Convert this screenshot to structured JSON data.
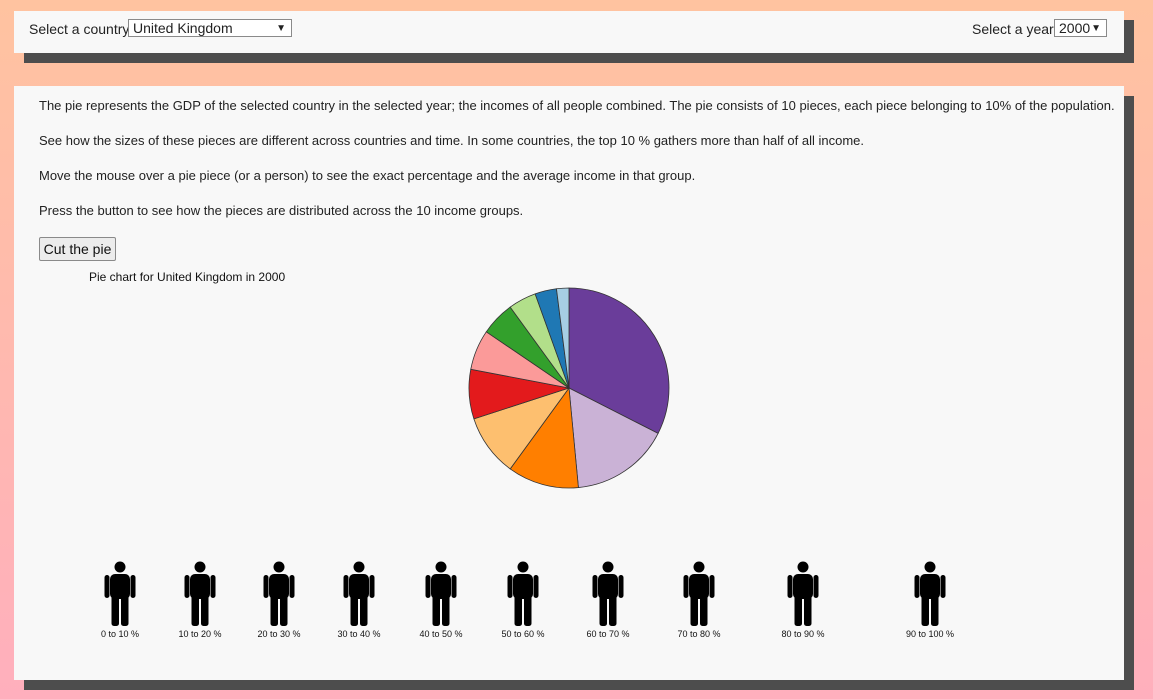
{
  "controls": {
    "country_label": "Select a country:",
    "country_value": "United Kingdom",
    "year_label": "Select a year:",
    "year_value": "2000"
  },
  "intro": [
    "The pie represents the GDP of the selected country in the selected year; the incomes of all people combined. The pie consists of 10 pieces, each piece belonging to 10% of the population.",
    "See how the sizes of these pieces are different across countries and time. In some countries, the top 10 % gathers more than half of all income.",
    "Move the mouse over a pie piece (or a person) to see the exact percentage and the average income in that group.",
    "Press the button to see how the pieces are distributed across the 10 income groups."
  ],
  "button_label": "Cut the pie",
  "chart_title": "Pie chart for United Kingdom in 2000",
  "chart_data": {
    "type": "pie",
    "title": "Pie chart for United Kingdom in 2000",
    "categories": [
      "90 to 100 %",
      "80 to 90 %",
      "70 to 80 %",
      "60 to 70 %",
      "50 to 60 %",
      "40 to 50 %",
      "30 to 40 %",
      "20 to 30 %",
      "10 to 20 %",
      "0 to 10 %"
    ],
    "values": [
      32.5,
      16.0,
      11.5,
      10.0,
      8.0,
      6.5,
      5.5,
      4.5,
      3.5,
      2.0
    ],
    "colors": [
      "#6a3d9a",
      "#cab2d6",
      "#ff7f00",
      "#fdbf6f",
      "#e31a1c",
      "#fb9a99",
      "#33a02c",
      "#b2df8a",
      "#1f78b4",
      "#a6cee3"
    ]
  },
  "people": [
    {
      "label": "0 to 10 %"
    },
    {
      "label": "10 to 20 %"
    },
    {
      "label": "20 to 30 %"
    },
    {
      "label": "30 to 40 %"
    },
    {
      "label": "40 to 50 %"
    },
    {
      "label": "50 to 60 %"
    },
    {
      "label": "60 to 70 %"
    },
    {
      "label": "70 to 80 %"
    },
    {
      "label": "80 to 90 %"
    },
    {
      "label": "90 to 100 %"
    }
  ]
}
